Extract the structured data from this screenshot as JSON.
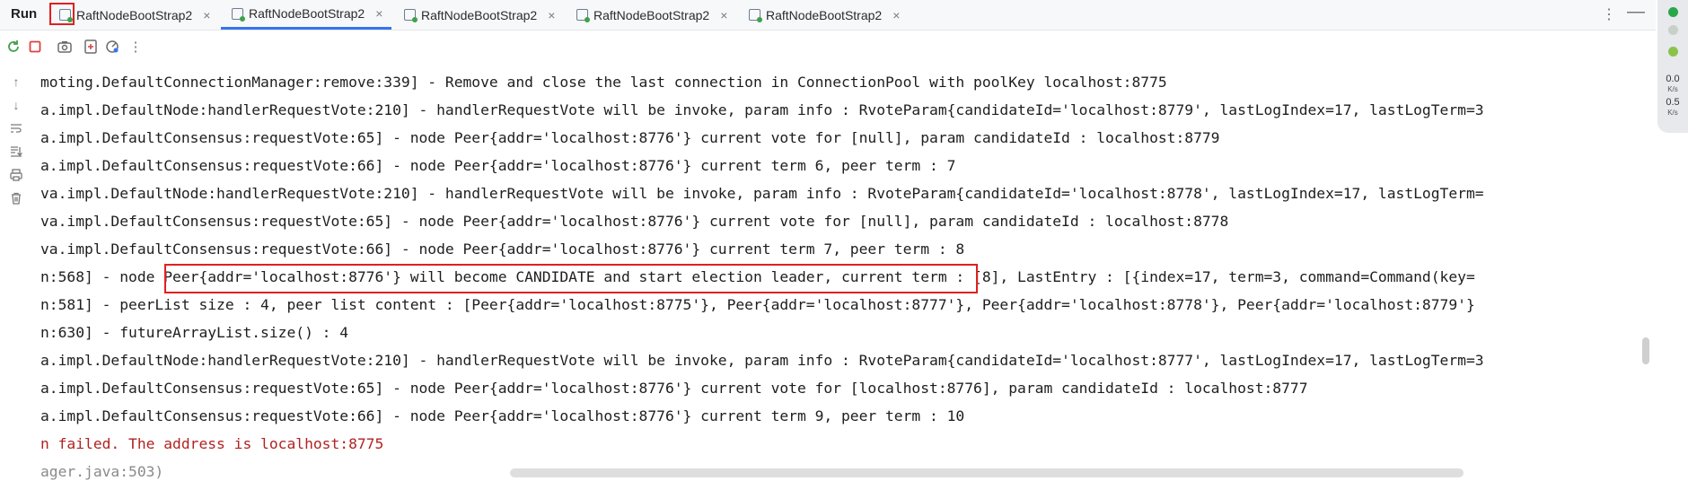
{
  "run_panel": {
    "label": "Run",
    "tabs": [
      {
        "label": "RaftNodeBootStrap2",
        "close": "×"
      },
      {
        "label": "RaftNodeBootStrap2",
        "close": "×"
      },
      {
        "label": "RaftNodeBootStrap2",
        "close": "×"
      },
      {
        "label": "RaftNodeBootStrap2",
        "close": "×"
      },
      {
        "label": "RaftNodeBootStrap2",
        "close": "×"
      }
    ],
    "active_tab_index": 1,
    "more_icon": "⋮",
    "minimize_icon": "—"
  },
  "toolbar": {
    "icons": [
      "rerun-icon",
      "stop-icon",
      "screenshot-icon",
      "restore-layout-icon",
      "coverage-icon",
      "more-icon"
    ]
  },
  "gutter": {
    "icons": [
      "up-arrow-icon",
      "down-arrow-icon",
      "soft-wrap-icon",
      "scroll-to-end-icon",
      "print-icon",
      "trash-icon"
    ]
  },
  "console": {
    "lines": [
      {
        "text": "moting.DefaultConnectionManager:remove:339] - Remove and close the last connection in ConnectionPool with poolKey localhost:8775",
        "style": "normal"
      },
      {
        "text": "a.impl.DefaultNode:handlerRequestVote:210] - handlerRequestVote will be invoke, param info : RvoteParam{candidateId='localhost:8779', lastLogIndex=17, lastLogTerm=3",
        "style": "normal"
      },
      {
        "text": "a.impl.DefaultConsensus:requestVote:65] - node Peer{addr='localhost:8776'} current vote for [null], param candidateId : localhost:8779",
        "style": "normal"
      },
      {
        "text": "a.impl.DefaultConsensus:requestVote:66] - node Peer{addr='localhost:8776'} current term 6, peer term : 7",
        "style": "normal"
      },
      {
        "text": "va.impl.DefaultNode:handlerRequestVote:210] - handlerRequestVote will be invoke, param info : RvoteParam{candidateId='localhost:8778', lastLogIndex=17, lastLogTerm=",
        "style": "normal"
      },
      {
        "text": "va.impl.DefaultConsensus:requestVote:65] - node Peer{addr='localhost:8776'} current vote for [null], param candidateId : localhost:8778",
        "style": "normal"
      },
      {
        "text": "va.impl.DefaultConsensus:requestVote:66] - node Peer{addr='localhost:8776'} current term 7, peer term : 8",
        "style": "normal"
      },
      {
        "text": "n:568] - node Peer{addr='localhost:8776'} will become CANDIDATE and start election leader, current term : [8], LastEntry : [{index=17, term=3, command=Command(key=",
        "style": "normal"
      },
      {
        "text": "n:581] - peerList size : 4, peer list content : [Peer{addr='localhost:8775'}, Peer{addr='localhost:8777'}, Peer{addr='localhost:8778'}, Peer{addr='localhost:8779'}",
        "style": "normal"
      },
      {
        "text": "n:630] - futureArrayList.size() : 4",
        "style": "normal"
      },
      {
        "text": "a.impl.DefaultNode:handlerRequestVote:210] - handlerRequestVote will be invoke, param info : RvoteParam{candidateId='localhost:8777', lastLogIndex=17, lastLogTerm=3",
        "style": "normal"
      },
      {
        "text": "a.impl.DefaultConsensus:requestVote:65] - node Peer{addr='localhost:8776'} current vote for [localhost:8776], param candidateId : localhost:8777",
        "style": "normal"
      },
      {
        "text": "a.impl.DefaultConsensus:requestVote:66] - node Peer{addr='localhost:8776'} current term 9, peer term : 10",
        "style": "normal"
      },
      {
        "text": "n failed. The address is localhost:8775",
        "style": "err"
      },
      {
        "text": "ager.java:503)",
        "style": "faint"
      }
    ]
  },
  "side_widget": {
    "upload_value": "0.0",
    "upload_unit": "K/s",
    "download_value": "0.5",
    "download_unit": "K/s",
    "colors": {
      "top": "#2aa64a",
      "mid": "#8bc34a"
    }
  }
}
